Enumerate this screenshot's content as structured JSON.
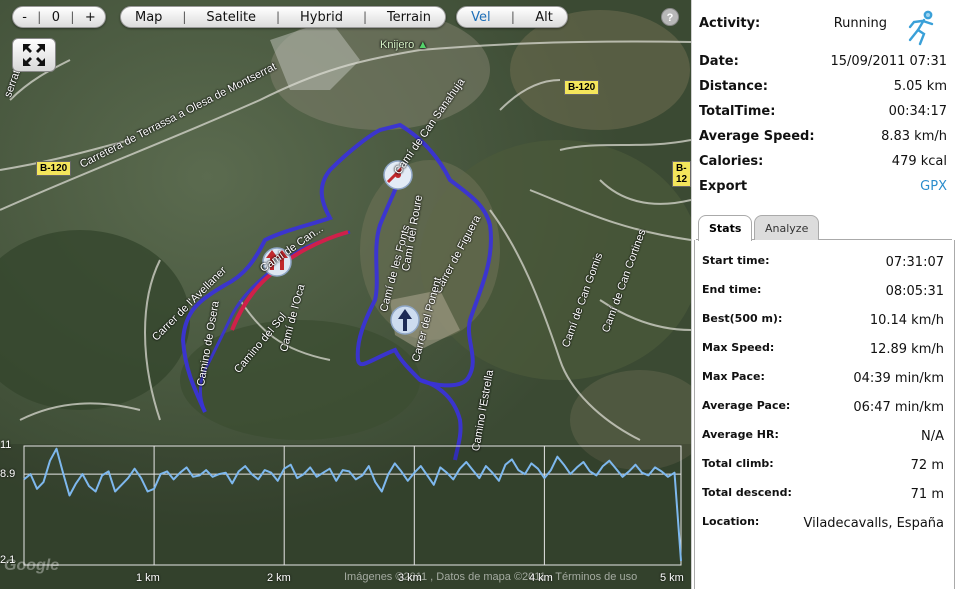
{
  "map_controls": {
    "zoom_out": "-",
    "zoom_reset": "0",
    "zoom_in": "+",
    "map_types": [
      "Map",
      "Satelite",
      "Hybrid",
      "Terrain"
    ],
    "chart_modes": [
      "Vel",
      "Alt"
    ],
    "active_chart_mode": "Vel",
    "help": "?"
  },
  "map_labels": {
    "knijero": "Knijero",
    "road_b120_left": "B-120",
    "road_b120_right": "B-120",
    "road_b120_edge": "B-12",
    "carretera": "Carretera de Terrassa a Olesa de Montserrat",
    "serrat": "serrat",
    "cami_can_sanahuja": "Camí de Can Sanahuja",
    "carrer_figuera": "Carrer de Figuera",
    "cami_roure": "Camí del Roure",
    "cami_fonts": "Camí de les Fonts",
    "carrer_ponent": "Carrer del Ponent",
    "cami_can_cortines": "Camí de Can Cortines",
    "cami_can_gomis": "Camí de Can Gomis",
    "cami_oca": "Camí de l'Oca",
    "carrer_avellaner": "Carrer de l'Avellaner",
    "camino_sol": "Camino del Sol",
    "camino_osera": "Camino de Osera",
    "cami_cami": "Camí de Can...",
    "cami_estrella": "Camino l'Estrella"
  },
  "elevation": {
    "y_ticks": [
      "11",
      "8.9",
      "2.1"
    ],
    "x_ticks": [
      "1 km",
      "2 km",
      "3 km",
      "4 km",
      "5 km"
    ],
    "attribution": "Imágenes ©2011 , Datos de mapa ©2011 - Términos de uso",
    "google": "Google"
  },
  "summary": {
    "activity_label": "Activity:",
    "activity_value": "Running",
    "date_label": "Date:",
    "date_value": "15/09/2011 07:31",
    "distance_label": "Distance:",
    "distance_value": "5.05 km",
    "totaltime_label": "TotalTime:",
    "totaltime_value": "00:34:17",
    "avgspeed_label": "Average Speed:",
    "avgspeed_value": "8.83 km/h",
    "calories_label": "Calories:",
    "calories_value": "479 kcal",
    "export_label": "Export",
    "export_value": "GPX"
  },
  "tabs": {
    "stats": "Stats",
    "analyze": "Analyze"
  },
  "stats": [
    {
      "label": "Start time:",
      "value": "07:31:07"
    },
    {
      "label": "End time:",
      "value": "08:05:31"
    },
    {
      "label": "Best(500 m):",
      "value": "10.14 km/h"
    },
    {
      "label": "Max Speed:",
      "value": "12.89 km/h"
    },
    {
      "label": "Max Pace:",
      "value": "04:39 min/km"
    },
    {
      "label": "Average Pace:",
      "value": "06:47 min/km"
    },
    {
      "label": "Average HR:",
      "value": "N/A"
    },
    {
      "label": "Total climb:",
      "value": "72 m"
    },
    {
      "label": "Total descend:",
      "value": "71 m"
    },
    {
      "label": "Location:",
      "value": "Viladecavalls, España"
    }
  ],
  "colors": {
    "track": "#3a33d6",
    "track_fast": "#d0204a",
    "speed_line": "#7eb8ee",
    "link": "#2a8ccc"
  },
  "chart_data": {
    "type": "line",
    "title": "",
    "xlabel": "",
    "ylabel": "",
    "x_unit": "km",
    "xlim": [
      0,
      5.05
    ],
    "ylim": [
      2.1,
      11
    ],
    "x": [
      0.0,
      0.05,
      0.1,
      0.15,
      0.2,
      0.25,
      0.3,
      0.35,
      0.4,
      0.45,
      0.5,
      0.55,
      0.6,
      0.65,
      0.7,
      0.75,
      0.8,
      0.85,
      0.9,
      0.95,
      1.0,
      1.05,
      1.1,
      1.15,
      1.2,
      1.25,
      1.3,
      1.35,
      1.4,
      1.45,
      1.5,
      1.55,
      1.6,
      1.65,
      1.7,
      1.75,
      1.8,
      1.85,
      1.9,
      1.95,
      2.0,
      2.05,
      2.1,
      2.15,
      2.2,
      2.25,
      2.3,
      2.35,
      2.4,
      2.45,
      2.5,
      2.55,
      2.6,
      2.65,
      2.7,
      2.75,
      2.8,
      2.85,
      2.9,
      2.95,
      3.0,
      3.05,
      3.1,
      3.15,
      3.2,
      3.25,
      3.3,
      3.35,
      3.4,
      3.45,
      3.5,
      3.55,
      3.6,
      3.65,
      3.7,
      3.75,
      3.8,
      3.85,
      3.9,
      3.95,
      4.0,
      4.05,
      4.1,
      4.15,
      4.2,
      4.25,
      4.3,
      4.35,
      4.4,
      4.45,
      4.5,
      4.55,
      4.6,
      4.65,
      4.7,
      4.75,
      4.8,
      4.85,
      4.9,
      4.95,
      5.0,
      5.05
    ],
    "values": [
      8.5,
      8.9,
      7.8,
      8.3,
      9.9,
      10.8,
      9.0,
      7.3,
      8.2,
      8.9,
      8.0,
      7.6,
      8.8,
      9.1,
      7.6,
      8.1,
      8.6,
      9.3,
      8.6,
      7.6,
      7.8,
      8.9,
      9.1,
      8.5,
      9.0,
      9.4,
      8.7,
      8.8,
      9.2,
      8.7,
      8.9,
      9.0,
      8.2,
      9.1,
      9.5,
      8.9,
      8.5,
      9.2,
      9.0,
      8.4,
      9.3,
      9.6,
      8.6,
      8.9,
      9.4,
      8.7,
      9.0,
      9.3,
      8.4,
      9.2,
      9.1,
      8.5,
      8.8,
      9.5,
      8.3,
      7.6,
      8.9,
      9.7,
      9.1,
      8.4,
      9.0,
      9.5,
      8.8,
      8.1,
      9.4,
      9.0,
      8.5,
      9.3,
      9.8,
      9.2,
      8.6,
      9.5,
      9.0,
      8.4,
      9.6,
      10.0,
      9.2,
      8.9,
      9.7,
      9.3,
      8.6,
      9.2,
      10.2,
      9.6,
      8.9,
      9.4,
      9.8,
      9.1,
      8.8,
      9.5,
      9.9,
      9.3,
      8.7,
      9.1,
      9.6,
      9.0,
      8.8,
      9.4,
      9.1,
      8.7,
      9.0,
      2.4
    ]
  }
}
